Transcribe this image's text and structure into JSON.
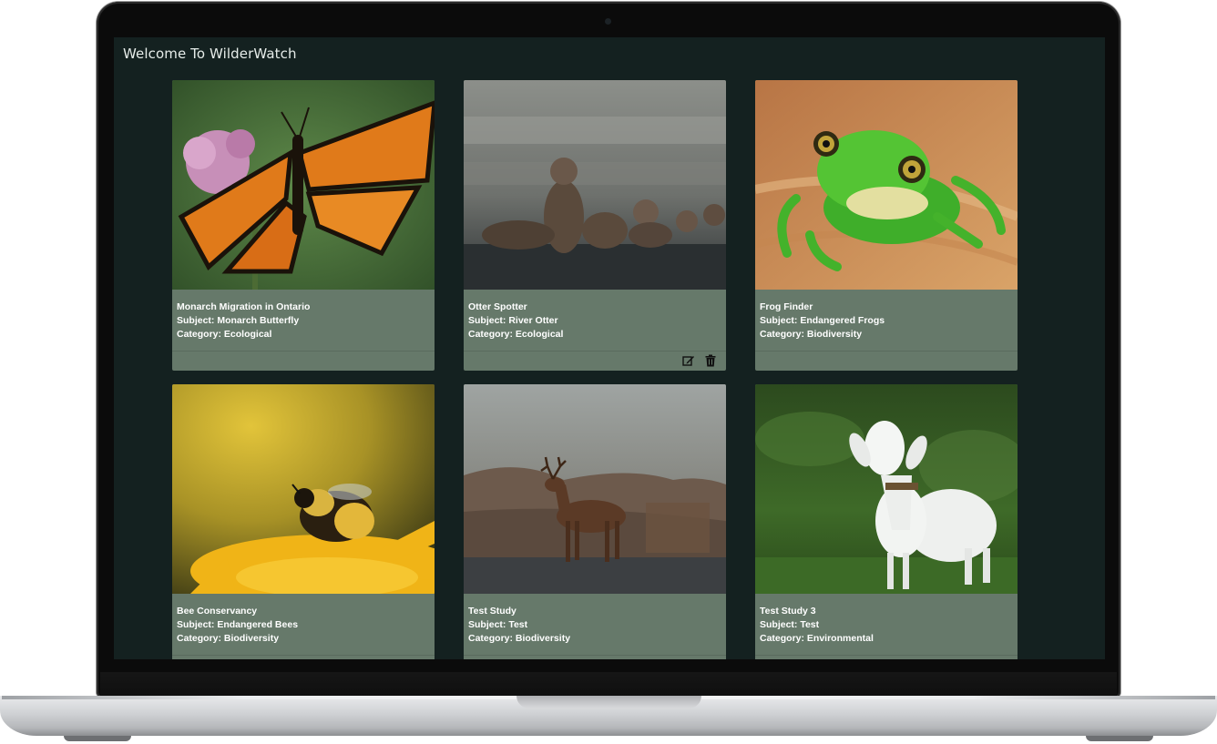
{
  "app": {
    "title": "Welcome To WilderWatch"
  },
  "studies": [
    {
      "title": "Monarch Migration in Ontario",
      "subject": "Subject: Monarch Butterfly",
      "category": "Category: Ecological",
      "image_icon": "butterfly-photo"
    },
    {
      "title": "Otter Spotter",
      "subject": "Subject: River Otter",
      "category": "Category: Ecological",
      "image_icon": "otter-photo",
      "actions": {
        "edit_icon": "edit-icon",
        "delete_icon": "trash-icon"
      }
    },
    {
      "title": "Frog Finder",
      "subject": "Subject: Endangered Frogs",
      "category": "Category: Biodiversity",
      "image_icon": "frog-photo"
    },
    {
      "title": "Bee Conservancy",
      "subject": "Subject: Endangered Bees",
      "category": "Category: Biodiversity",
      "image_icon": "bee-photo"
    },
    {
      "title": "Test Study",
      "subject": "Subject: Test",
      "category": "Category: Biodiversity",
      "image_icon": "deer-photo"
    },
    {
      "title": "Test Study 3",
      "subject": "Subject: Test",
      "category": "Category: Environmental",
      "image_icon": "goat-photo"
    }
  ],
  "colors": {
    "background": "#142120",
    "card": "#66796a",
    "text": "#ffffff"
  }
}
